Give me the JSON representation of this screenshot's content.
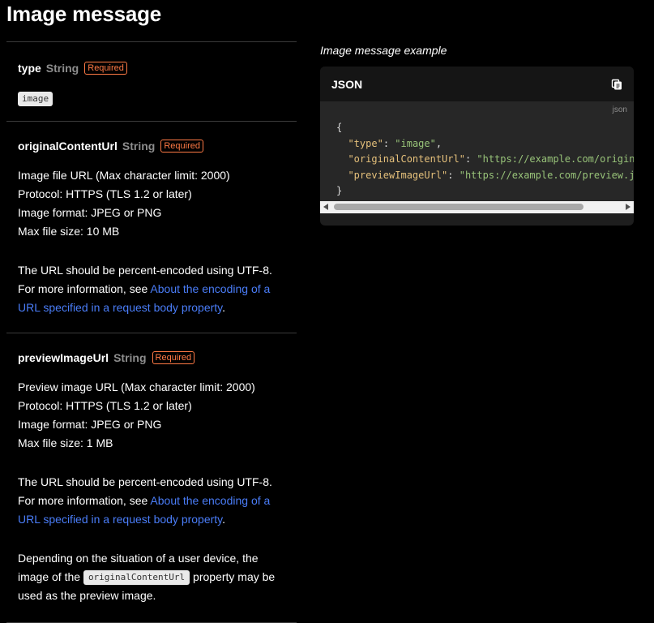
{
  "page_title": "Image message",
  "properties": [
    {
      "name": "type",
      "type": "String",
      "badge": "Required",
      "value_chip": "image"
    },
    {
      "name": "originalContentUrl",
      "type": "String",
      "badge": "Required",
      "lines": [
        "Image file URL (Max character limit: 2000)",
        "Protocol: HTTPS (TLS 1.2 or later)",
        "Image format: JPEG or PNG",
        "Max file size: 10 MB"
      ],
      "encoding_line": "The URL should be percent-encoded using UTF-8.",
      "more_info_prefix": "For more information, see ",
      "more_info_link": "About the encoding of a URL specified in a request body property",
      "more_info_suffix": "."
    },
    {
      "name": "previewImageUrl",
      "type": "String",
      "badge": "Required",
      "lines": [
        "Preview image URL (Max character limit: 2000)",
        "Protocol: HTTPS (TLS 1.2 or later)",
        "Image format: JPEG or PNG",
        "Max file size: 1 MB"
      ],
      "encoding_line": "The URL should be percent-encoded using UTF-8.",
      "more_info_prefix": "For more information, see ",
      "more_info_link": "About the encoding of a URL specified in a request body property",
      "more_info_suffix": ".",
      "note_prefix": "Depending on the situation of a user device, the image of the ",
      "note_code": "originalContentUrl",
      "note_suffix": " property may be used as the preview image."
    }
  ],
  "example": {
    "title": "Image message example",
    "header": "JSON",
    "lang": "json",
    "code": {
      "open": "{",
      "close": "}",
      "lines": [
        {
          "key": "\"type\"",
          "value": "\"image\"",
          "trail": ","
        },
        {
          "key": "\"originalContentUrl\"",
          "value": "\"https://example.com/original.",
          "trail": ""
        },
        {
          "key": "\"previewImageUrl\"",
          "value": "\"https://example.com/preview.jpg\"",
          "trail": ""
        }
      ]
    }
  },
  "icons": {
    "copy": "copy-icon",
    "scroll_left": "chevron-left-icon",
    "scroll_right": "chevron-right-icon"
  },
  "colors": {
    "background": "#000000",
    "badge": "#ff7a45",
    "link": "#4a7df8",
    "json_key": "#e5c07b",
    "json_string": "#98c379"
  }
}
